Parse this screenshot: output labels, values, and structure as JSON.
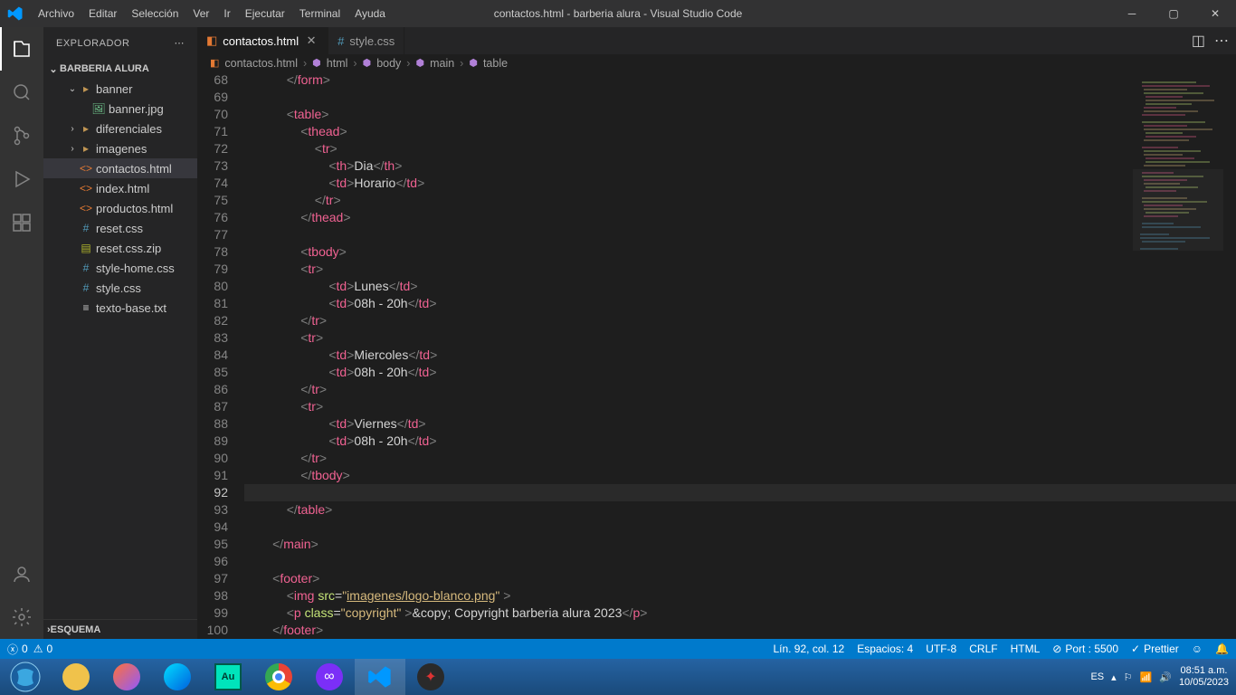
{
  "title": "contactos.html - barberia alura - Visual Studio Code",
  "menu": [
    "Archivo",
    "Editar",
    "Selección",
    "Ver",
    "Ir",
    "Ejecutar",
    "Terminal",
    "Ayuda"
  ],
  "sidebar": {
    "header": "EXPLORADOR",
    "project": "BARBERIA ALURA",
    "tree": [
      {
        "type": "folder",
        "open": true,
        "name": "banner",
        "indent": 1
      },
      {
        "type": "file",
        "icon": "img",
        "name": "banner.jpg",
        "indent": 2
      },
      {
        "type": "folder",
        "open": false,
        "name": "diferenciales",
        "indent": 1
      },
      {
        "type": "folder",
        "open": false,
        "name": "imagenes",
        "indent": 1
      },
      {
        "type": "file",
        "icon": "html",
        "name": "contactos.html",
        "indent": 1,
        "sel": true
      },
      {
        "type": "file",
        "icon": "html",
        "name": "index.html",
        "indent": 1
      },
      {
        "type": "file",
        "icon": "html",
        "name": "productos.html",
        "indent": 1
      },
      {
        "type": "file",
        "icon": "css",
        "name": "reset.css",
        "indent": 1
      },
      {
        "type": "file",
        "icon": "zip",
        "name": "reset.css.zip",
        "indent": 1
      },
      {
        "type": "file",
        "icon": "css",
        "name": "style-home.css",
        "indent": 1
      },
      {
        "type": "file",
        "icon": "css",
        "name": "style.css",
        "indent": 1
      },
      {
        "type": "file",
        "icon": "txt",
        "name": "texto-base.txt",
        "indent": 1
      }
    ],
    "bottom": "ESQUEMA"
  },
  "tabs": [
    {
      "icon": "html",
      "label": "contactos.html",
      "active": true,
      "close": true
    },
    {
      "icon": "css",
      "label": "style.css",
      "active": false,
      "close": false
    }
  ],
  "breadcrumb": [
    {
      "icon": "html",
      "label": "contactos.html",
      "itype": "file"
    },
    {
      "icon": "sym",
      "label": "html"
    },
    {
      "icon": "sym",
      "label": "body"
    },
    {
      "icon": "sym",
      "label": "main"
    },
    {
      "icon": "sym",
      "label": "table"
    }
  ],
  "gutter_start": 68,
  "gutter_end": 100,
  "current_line": 92,
  "code_lines": [
    [
      [
        "sp",
        "            "
      ],
      [
        "a",
        "</"
      ],
      [
        "t",
        "form"
      ],
      [
        "a",
        ">"
      ]
    ],
    [
      [
        "sp",
        ""
      ]
    ],
    [
      [
        "sp",
        "            "
      ],
      [
        "a",
        "<"
      ],
      [
        "t",
        "table"
      ],
      [
        "a",
        ">"
      ]
    ],
    [
      [
        "sp",
        "                "
      ],
      [
        "a",
        "<"
      ],
      [
        "t",
        "thead"
      ],
      [
        "a",
        ">"
      ]
    ],
    [
      [
        "sp",
        "                    "
      ],
      [
        "a",
        "<"
      ],
      [
        "t",
        "tr"
      ],
      [
        "a",
        ">"
      ]
    ],
    [
      [
        "sp",
        "                        "
      ],
      [
        "a",
        "<"
      ],
      [
        "t",
        "th"
      ],
      [
        "a",
        ">"
      ],
      [
        "x",
        "Dia"
      ],
      [
        "a",
        "</"
      ],
      [
        "t",
        "th"
      ],
      [
        "a",
        ">"
      ]
    ],
    [
      [
        "sp",
        "                        "
      ],
      [
        "a",
        "<"
      ],
      [
        "t",
        "td"
      ],
      [
        "a",
        ">"
      ],
      [
        "x",
        "Horario"
      ],
      [
        "a",
        "</"
      ],
      [
        "t",
        "td"
      ],
      [
        "a",
        ">"
      ]
    ],
    [
      [
        "sp",
        "                    "
      ],
      [
        "a",
        "</"
      ],
      [
        "t",
        "tr"
      ],
      [
        "a",
        ">"
      ]
    ],
    [
      [
        "sp",
        "                "
      ],
      [
        "a",
        "</"
      ],
      [
        "t",
        "thead"
      ],
      [
        "a",
        ">"
      ]
    ],
    [
      [
        "sp",
        ""
      ]
    ],
    [
      [
        "sp",
        "                "
      ],
      [
        "a",
        "<"
      ],
      [
        "t",
        "tbody"
      ],
      [
        "a",
        ">"
      ]
    ],
    [
      [
        "sp",
        "                "
      ],
      [
        "a",
        "<"
      ],
      [
        "t",
        "tr"
      ],
      [
        "a",
        ">"
      ]
    ],
    [
      [
        "sp",
        "                        "
      ],
      [
        "a",
        "<"
      ],
      [
        "t",
        "td"
      ],
      [
        "a",
        ">"
      ],
      [
        "x",
        "Lunes"
      ],
      [
        "a",
        "</"
      ],
      [
        "t",
        "td"
      ],
      [
        "a",
        ">"
      ]
    ],
    [
      [
        "sp",
        "                        "
      ],
      [
        "a",
        "<"
      ],
      [
        "t",
        "td"
      ],
      [
        "a",
        ">"
      ],
      [
        "x",
        "08h - 20h"
      ],
      [
        "a",
        "</"
      ],
      [
        "t",
        "td"
      ],
      [
        "a",
        ">"
      ]
    ],
    [
      [
        "sp",
        "                "
      ],
      [
        "a",
        "</"
      ],
      [
        "t",
        "tr"
      ],
      [
        "a",
        ">"
      ]
    ],
    [
      [
        "sp",
        "                "
      ],
      [
        "a",
        "<"
      ],
      [
        "t",
        "tr"
      ],
      [
        "a",
        ">"
      ]
    ],
    [
      [
        "sp",
        "                        "
      ],
      [
        "a",
        "<"
      ],
      [
        "t",
        "td"
      ],
      [
        "a",
        ">"
      ],
      [
        "x",
        "Miercoles"
      ],
      [
        "a",
        "</"
      ],
      [
        "t",
        "td"
      ],
      [
        "a",
        ">"
      ]
    ],
    [
      [
        "sp",
        "                        "
      ],
      [
        "a",
        "<"
      ],
      [
        "t",
        "td"
      ],
      [
        "a",
        ">"
      ],
      [
        "x",
        "08h - 20h"
      ],
      [
        "a",
        "</"
      ],
      [
        "t",
        "td"
      ],
      [
        "a",
        ">"
      ]
    ],
    [
      [
        "sp",
        "                "
      ],
      [
        "a",
        "</"
      ],
      [
        "t",
        "tr"
      ],
      [
        "a",
        ">"
      ]
    ],
    [
      [
        "sp",
        "                "
      ],
      [
        "a",
        "<"
      ],
      [
        "t",
        "tr"
      ],
      [
        "a",
        ">"
      ]
    ],
    [
      [
        "sp",
        "                        "
      ],
      [
        "a",
        "<"
      ],
      [
        "t",
        "td"
      ],
      [
        "a",
        ">"
      ],
      [
        "x",
        "Viernes"
      ],
      [
        "a",
        "</"
      ],
      [
        "t",
        "td"
      ],
      [
        "a",
        ">"
      ]
    ],
    [
      [
        "sp",
        "                        "
      ],
      [
        "a",
        "<"
      ],
      [
        "t",
        "td"
      ],
      [
        "a",
        ">"
      ],
      [
        "x",
        "08h - 20h"
      ],
      [
        "a",
        "</"
      ],
      [
        "t",
        "td"
      ],
      [
        "a",
        ">"
      ]
    ],
    [
      [
        "sp",
        "                "
      ],
      [
        "a",
        "</"
      ],
      [
        "t",
        "tr"
      ],
      [
        "a",
        ">"
      ]
    ],
    [
      [
        "sp",
        "                "
      ],
      [
        "a",
        "</"
      ],
      [
        "t",
        "tbody"
      ],
      [
        "a",
        ">"
      ]
    ],
    [
      [
        "sp",
        "                "
      ]
    ],
    [
      [
        "sp",
        "            "
      ],
      [
        "a",
        "</"
      ],
      [
        "t",
        "table"
      ],
      [
        "a",
        ">"
      ]
    ],
    [
      [
        "sp",
        ""
      ]
    ],
    [
      [
        "sp",
        "        "
      ],
      [
        "a",
        "</"
      ],
      [
        "t",
        "main"
      ],
      [
        "a",
        ">"
      ]
    ],
    [
      [
        "sp",
        ""
      ]
    ],
    [
      [
        "sp",
        "        "
      ],
      [
        "a",
        "<"
      ],
      [
        "t",
        "footer"
      ],
      [
        "a",
        ">"
      ]
    ],
    [
      [
        "sp",
        "            "
      ],
      [
        "a",
        "<"
      ],
      [
        "t",
        "img "
      ],
      [
        "at",
        "src"
      ],
      [
        "op",
        "="
      ],
      [
        "s",
        "\""
      ],
      [
        "link",
        "imagenes/logo-blanco.png"
      ],
      [
        "s",
        "\" "
      ],
      [
        "a",
        ">"
      ]
    ],
    [
      [
        "sp",
        "            "
      ],
      [
        "a",
        "<"
      ],
      [
        "t",
        "p "
      ],
      [
        "at",
        "class"
      ],
      [
        "op",
        "="
      ],
      [
        "s",
        "\"copyright\" "
      ],
      [
        "a",
        ">"
      ],
      [
        "x",
        "&copy; Copyright barberia alura 2023"
      ],
      [
        "a",
        "</"
      ],
      [
        "t",
        "p"
      ],
      [
        "a",
        ">"
      ]
    ],
    [
      [
        "sp",
        "        "
      ],
      [
        "a",
        "</"
      ],
      [
        "t",
        "footer"
      ],
      [
        "a",
        ">"
      ]
    ]
  ],
  "status": {
    "errors": "0",
    "warnings": "0",
    "pos": "Lín. 92, col. 12",
    "spaces": "Espacios: 4",
    "enc": "UTF-8",
    "eol": "CRLF",
    "lang": "HTML",
    "port": "Port : 5500",
    "prettier": "Prettier"
  },
  "tray": {
    "lang": "ES",
    "time": "08:51 a.m.",
    "date": "10/05/2023"
  }
}
